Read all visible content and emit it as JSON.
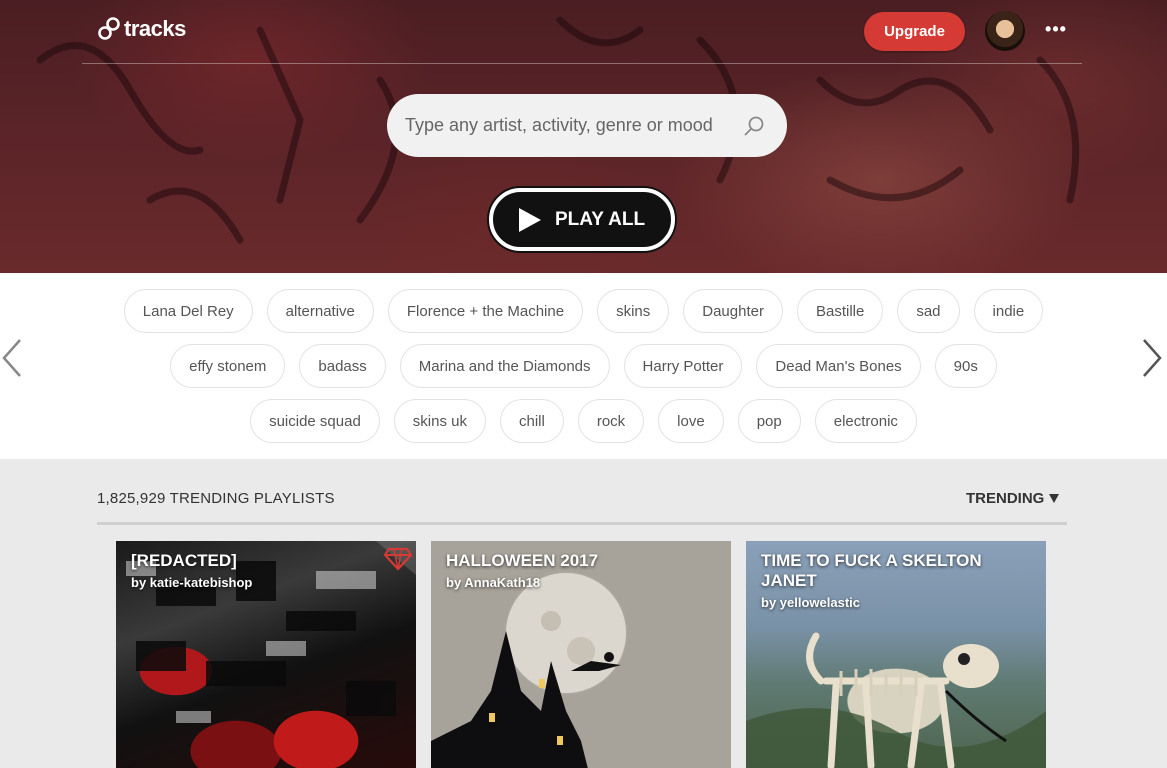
{
  "header": {
    "logo_text": "tracks",
    "upgrade_label": "Upgrade",
    "more_label": "•••"
  },
  "search": {
    "placeholder": "Type any artist, activity, genre or mood"
  },
  "play_all_label": "PLAY ALL",
  "tags": {
    "row1": [
      "Lana Del Rey",
      "alternative",
      "Florence + the Machine",
      "skins",
      "Daughter",
      "Bastille",
      "sad",
      "indie"
    ],
    "row2": [
      "effy stonem",
      "badass",
      "Marina and the Diamonds",
      "Harry Potter",
      "Dead Man's Bones",
      "90s"
    ],
    "row3": [
      "suicide squad",
      "skins uk",
      "chill",
      "rock",
      "love",
      "pop",
      "electronic"
    ]
  },
  "main": {
    "section_title": "1,825,929 TRENDING PLAYLISTS",
    "sort_label": "TRENDING"
  },
  "playlists": [
    {
      "title": "[redacted]",
      "by": "by katie-katebishop"
    },
    {
      "title": "HALLOWEEN 2017",
      "by": "by AnnaKath18"
    },
    {
      "title": "TIME TO FUCK A SKELTON JANET",
      "by": "by yellowelastic"
    }
  ],
  "colors": {
    "accent": "#d53a35",
    "hero_bg": "#5b2428"
  }
}
